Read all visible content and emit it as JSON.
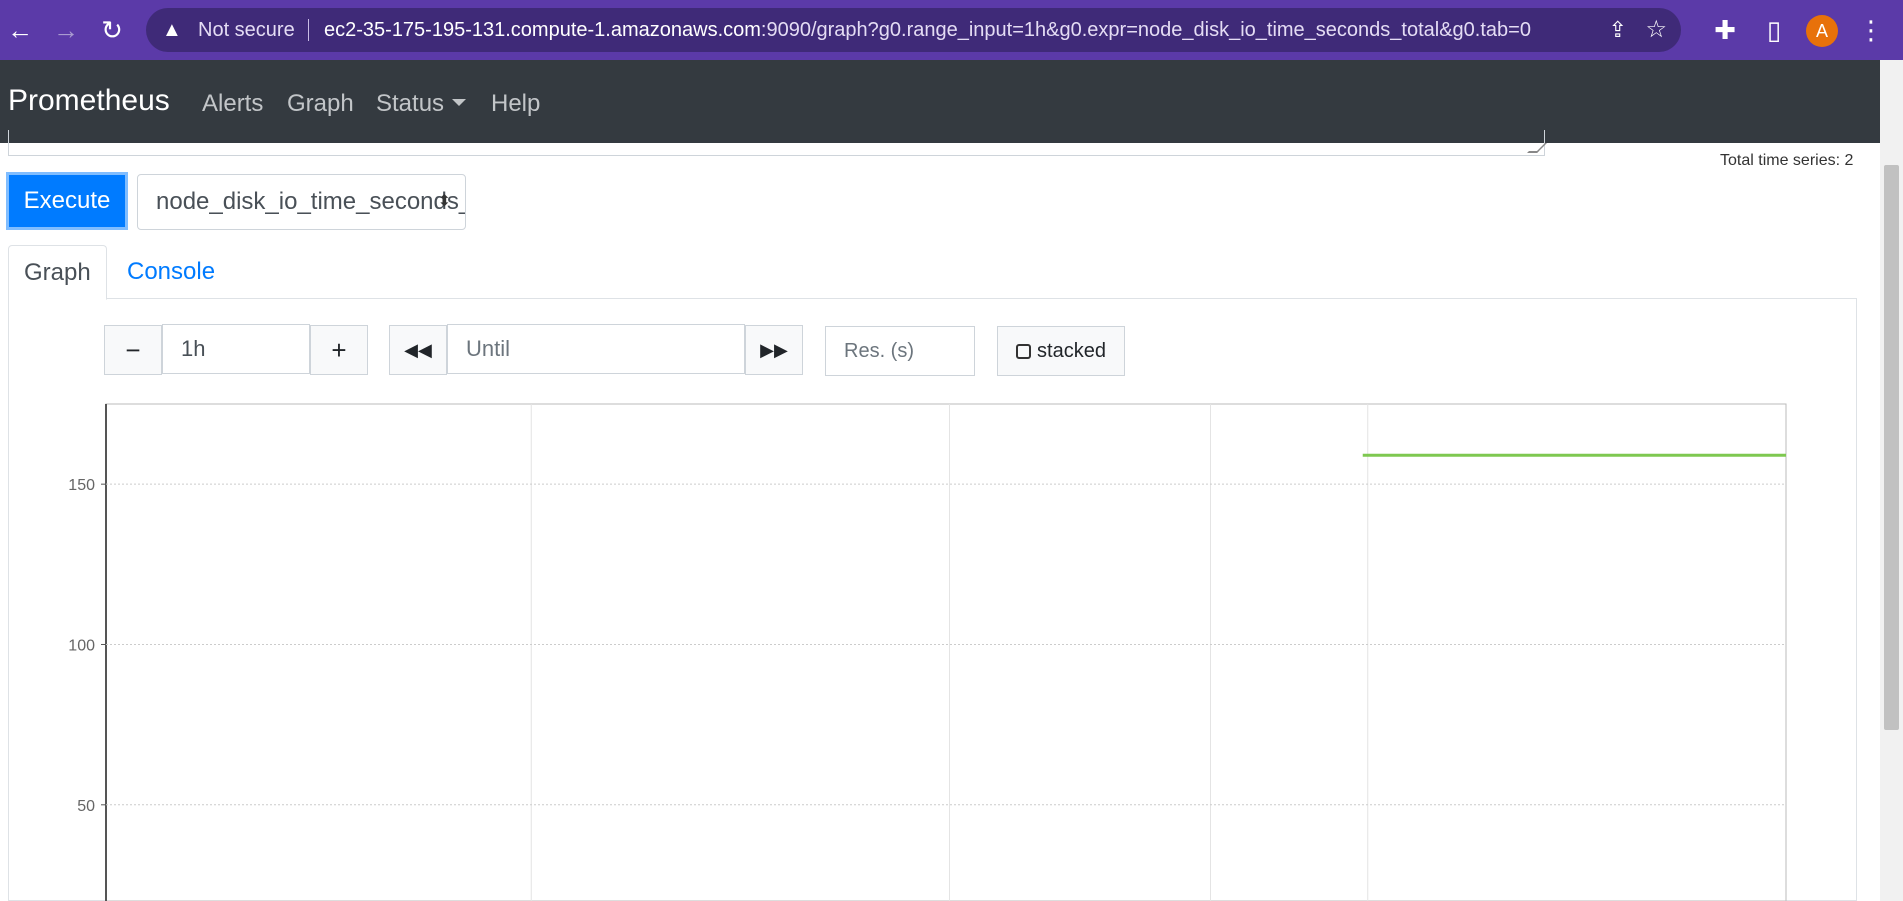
{
  "browser": {
    "security_label": "Not secure",
    "url_host": "ec2-35-175-195-131.compute-1.amazonaws.com",
    "url_rest": ":9090/graph?g0.range_input=1h&g0.expr=node_disk_io_time_seconds_total&g0.tab=0",
    "avatar_letter": "A",
    "colors": {
      "frame": "#5b3aa8",
      "omnibox": "#3f2a78"
    }
  },
  "navbar": {
    "brand": "Prometheus",
    "items": [
      {
        "label": "Alerts"
      },
      {
        "label": "Graph"
      },
      {
        "label": "Status"
      },
      {
        "label": "Help"
      }
    ]
  },
  "query": {
    "stats_total": "Total time series: 2",
    "execute_label": "Execute",
    "metric_select_value": "node_disk_io_time_seconds_total"
  },
  "tabs": [
    {
      "label": "Graph",
      "active": true
    },
    {
      "label": "Console",
      "active": false
    }
  ],
  "graph_controls": {
    "minus": "−",
    "range_value": "1h",
    "plus": "+",
    "back": "◀◀",
    "until_placeholder": "Until",
    "forward": "▶▶",
    "res_placeholder": "Res. (s)",
    "stacked_label": "stacked"
  },
  "chart_data": {
    "type": "line",
    "title": "",
    "xlabel": "",
    "ylabel": "",
    "y_ticks": [
      150,
      100,
      50
    ],
    "ylim": [
      20,
      175
    ],
    "xlim": [
      0,
      1
    ],
    "grid": true,
    "series": [
      {
        "color": "#7ec850",
        "x": [
          0.747,
          1.0
        ],
        "y": [
          159,
          159
        ]
      }
    ]
  }
}
